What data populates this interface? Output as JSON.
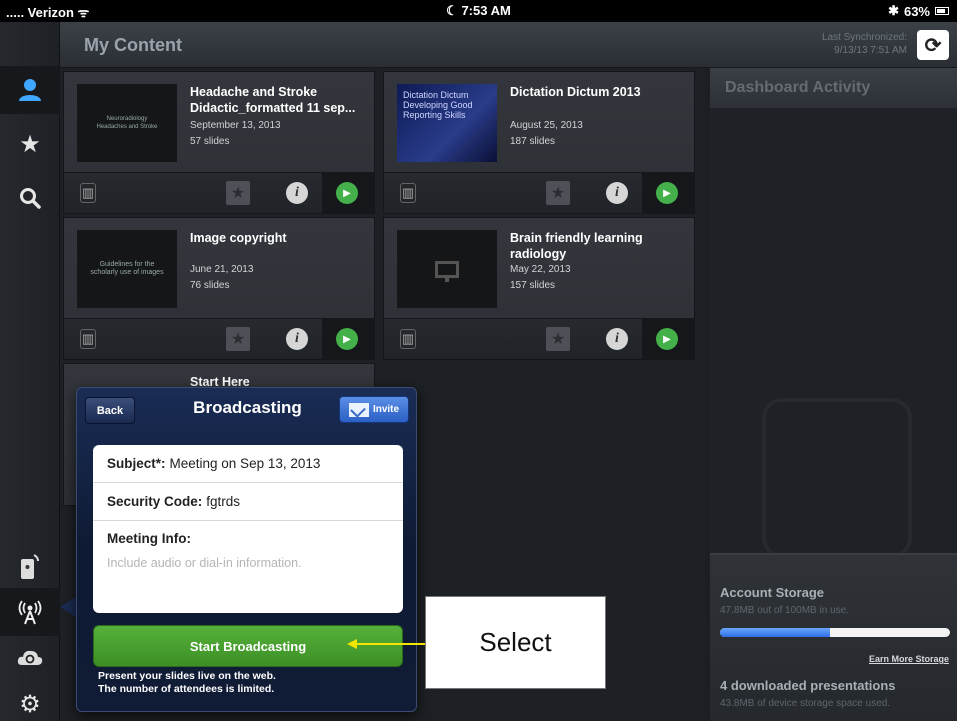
{
  "status_bar": {
    "carrier": "..... Verizon ᯤ",
    "time": "☾ 7:53 AM",
    "battery": "63%"
  },
  "header": {
    "title": "My Content",
    "sync_label": "Last Synchronized:",
    "sync_time": "9/13/13 7:51 AM",
    "sync_icon": "refresh-icon"
  },
  "nav": {
    "top_icons": [
      "person-icon",
      "star-icon",
      "search-icon"
    ],
    "bottom_icons": [
      "remote-icon",
      "broadcast-icon",
      "cloud-sync-icon",
      "gear-icon"
    ]
  },
  "cards": [
    {
      "title": "Headache and Stroke Didactic_formatted 11 sep...",
      "date": "September 13, 2013",
      "slides": "57 slides",
      "thumb": "Neuroradiology\nHeadaches and Stroke",
      "thumb_style": "dark"
    },
    {
      "title": "Dictation Dictum 2013",
      "date": "August 25, 2013",
      "slides": "187 slides",
      "thumb": "Dictation Dictum\nDeveloping Good\nReporting Skills",
      "thumb_style": "blue"
    },
    {
      "title": "Image copyright",
      "date": "June 21, 2013",
      "slides": "76 slides",
      "thumb": "Guidelines for the\nscholarly use of images",
      "thumb_style": "dark"
    },
    {
      "title": "Brain friendly learning radiology",
      "date": "May 22, 2013",
      "slides": "157 slides",
      "thumb": "",
      "thumb_style": "monitor"
    },
    {
      "title": "Start Here"
    }
  ],
  "dashboard": {
    "title": "Dashboard Activity",
    "storage_title": "Account Storage",
    "storage_sub": "47.8MB out of 100MB in use.",
    "storage_fraction": 0.478,
    "earn_more": "Earn More Storage",
    "downloaded": "4 downloaded presentations",
    "downloaded_sub": "43.8MB of device storage space used."
  },
  "popover": {
    "back": "Back",
    "title": "Broadcasting",
    "invite": "Invite",
    "subject_label": "Subject*:",
    "subject_value": "Meeting on Sep 13, 2013",
    "security_label": "Security Code:",
    "security_value": "fgtrds",
    "meeting_label": "Meeting Info:",
    "meeting_placeholder": "Include audio or dial-in information.",
    "start_button": "Start Broadcasting",
    "note_line1": "Present your slides live on the web.",
    "note_line2": "The number of attendees is limited."
  },
  "annotation": {
    "text": "Select",
    "arrow_color": "#f2e600"
  }
}
